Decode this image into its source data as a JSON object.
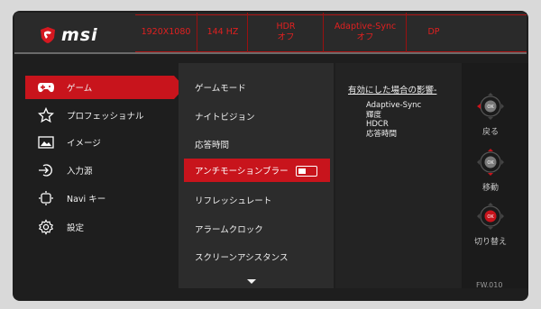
{
  "header": {
    "brand": "msi",
    "status": [
      {
        "line1": "1920X1080",
        "line2": ""
      },
      {
        "line1": "144 HZ",
        "line2": ""
      },
      {
        "line1": "HDR",
        "line2": "オフ"
      },
      {
        "line1": "Adaptive-Sync",
        "line2": "オフ"
      },
      {
        "line1": "DP",
        "line2": ""
      }
    ]
  },
  "sidebar": {
    "items": [
      {
        "label": "ゲーム",
        "icon": "gamepad-icon"
      },
      {
        "label": "プロフェッショナル",
        "icon": "star-icon"
      },
      {
        "label": "イメージ",
        "icon": "image-icon"
      },
      {
        "label": "入力源",
        "icon": "input-source-icon"
      },
      {
        "label": "Navi キー",
        "icon": "navi-key-icon"
      },
      {
        "label": "設定",
        "icon": "gear-icon"
      }
    ]
  },
  "submenu": {
    "items": [
      {
        "label": "ゲームモード"
      },
      {
        "label": "ナイトビジョン"
      },
      {
        "label": "応答時間"
      },
      {
        "label": "アンチモーションブラー"
      },
      {
        "label": "リフレッシュレート"
      },
      {
        "label": "アラームクロック"
      },
      {
        "label": "スクリーンアシスタンス"
      }
    ]
  },
  "info": {
    "title": "有効にした場合の影響-",
    "items": [
      "Adaptive-Sync",
      "輝度",
      "HDCR",
      "応答時間"
    ]
  },
  "controls": {
    "back": {
      "button": "OK",
      "label": "戻る"
    },
    "move": {
      "button": "OK",
      "label": "移動"
    },
    "toggle": {
      "button": "OK",
      "label": "切り替え"
    }
  },
  "firmware": "FW.010",
  "colors": {
    "accent": "#c8141c",
    "status_text": "#e02020"
  }
}
